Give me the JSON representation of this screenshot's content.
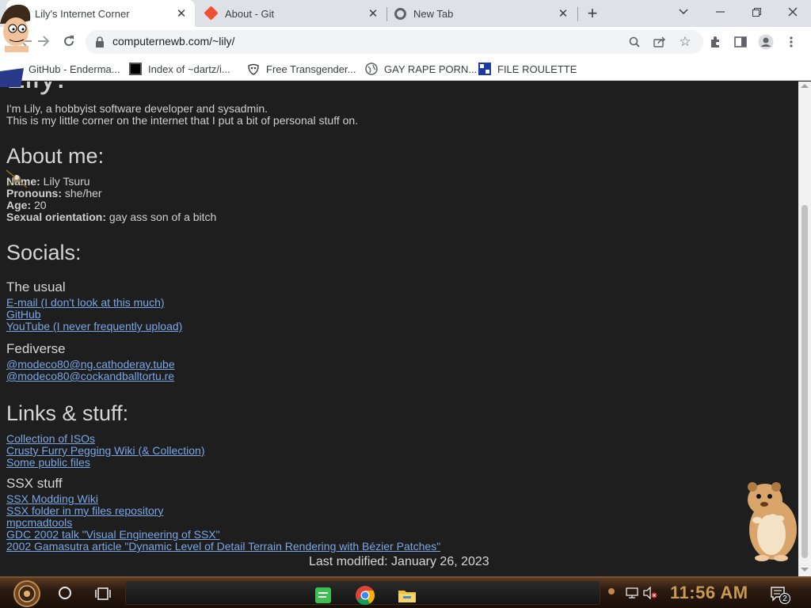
{
  "browser": {
    "tabs": [
      {
        "title": "Lily's Internet Corner",
        "active": true
      },
      {
        "title": "About - Git",
        "active": false
      },
      {
        "title": "New Tab",
        "active": false
      }
    ],
    "url": "computernewb.com/~lily/",
    "bookmarks": [
      {
        "label": "GitHub - Enderma...",
        "icon": "github-favicon"
      },
      {
        "label": "Index of ~dartz/i...",
        "icon": "index-favicon"
      },
      {
        "label": "Free Transgender...",
        "icon": "mask-favicon"
      },
      {
        "label": "GAY RAPE PORN...",
        "icon": "globe-favicon"
      },
      {
        "label": "FILE ROULETTE",
        "icon": "file-roulette-favicon"
      }
    ]
  },
  "page": {
    "intro": [
      "I'm Lily, a hobbyist software developer and sysadmin.",
      "This is my little corner on the internet that I put a bit of personal stuff on."
    ],
    "about": {
      "heading": "About me:",
      "fields": [
        {
          "label": "Name:",
          "value": " Lily Tsuru"
        },
        {
          "label": "Pronouns:",
          "value": " she/her"
        },
        {
          "label": "Age:",
          "value": " 20"
        },
        {
          "label": "Sexual orientation:",
          "value": " gay ass son of a bitch"
        }
      ]
    },
    "socials": {
      "heading": "Socials:",
      "usual_heading": "The usual",
      "usual_links": [
        "E-mail (I don't look at this much)",
        "GitHub",
        "YouTube (I never frequently upload)"
      ],
      "fediverse_heading": "Fediverse",
      "fediverse_links": [
        "@modeco80@ng.cathoderay.tube",
        "@modeco80@cockandballtortu.re"
      ]
    },
    "links": {
      "heading": "Links & stuff:",
      "items": [
        "Collection of ISOs",
        "Crusty Furry Pegging Wiki (& Collection)",
        "Some public files"
      ],
      "ssx_heading": "SSX stuff",
      "ssx_items": [
        "SSX Modding Wiki",
        "SSX folder in my files repository",
        "mpcmadtools",
        "GDC 2002 talk \"Visual Engineering of SSX\"",
        "2002 Gamasutra article \"Dynamic Level of Detail Terrain Rendering with Bézier Patches\""
      ]
    },
    "last_modified": "Last modified: January 26, 2023"
  },
  "taskbar": {
    "clock": "11:56 AM",
    "notification_count": "2"
  },
  "colors": {
    "page_bg": "#1e1e1e",
    "link": "#7aa6e6",
    "clock": "#c79a4e"
  }
}
